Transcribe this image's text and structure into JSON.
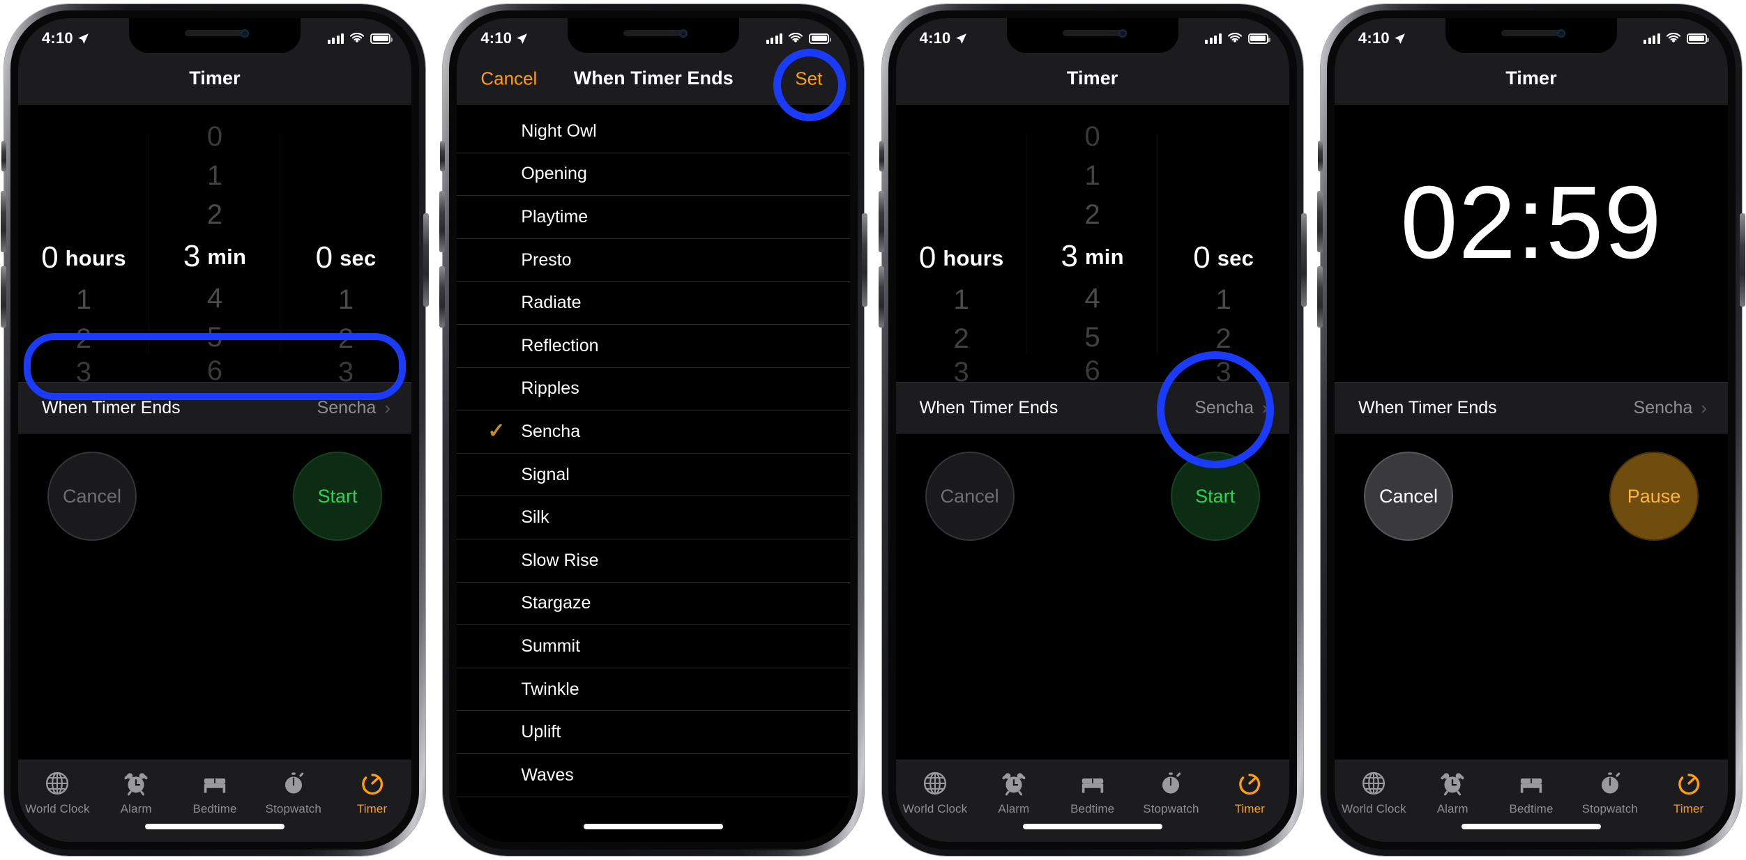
{
  "status_bar": {
    "time": "4:10",
    "location_icon": "location-arrow-icon",
    "cellular_icon": "cellular-bars-icon",
    "wifi_icon": "wifi-icon",
    "battery_icon": "battery-icon"
  },
  "tab_bar": {
    "items": [
      {
        "label": "World Clock",
        "icon": "globe-icon",
        "active": false
      },
      {
        "label": "Alarm",
        "icon": "alarm-clock-icon",
        "active": false
      },
      {
        "label": "Bedtime",
        "icon": "bed-icon",
        "active": false
      },
      {
        "label": "Stopwatch",
        "icon": "stopwatch-icon",
        "active": false
      },
      {
        "label": "Timer",
        "icon": "timer-icon",
        "active": true
      }
    ]
  },
  "colors": {
    "accent_orange": "#ff9f0a",
    "highlight_blue": "#1a3cfa",
    "start_green": "#30d158",
    "pause_orange": "#ffb340",
    "checkmark_gold": "#c78c2b"
  },
  "panel1": {
    "nav_title": "Timer",
    "picker": {
      "hours": {
        "above": [],
        "selected_value": "0",
        "selected_unit": "hours",
        "below": [
          "1",
          "2",
          "3"
        ]
      },
      "minutes": {
        "above": [
          "0",
          "1",
          "2"
        ],
        "selected_value": "3",
        "selected_unit": "min",
        "below": [
          "4",
          "5",
          "6"
        ]
      },
      "seconds": {
        "above": [],
        "selected_value": "0",
        "selected_unit": "sec",
        "below": [
          "1",
          "2",
          "3"
        ]
      }
    },
    "when_timer_ends": {
      "label": "When Timer Ends",
      "value": "Sencha",
      "chevron": "chevron-right-icon",
      "highlighted": true
    },
    "buttons": {
      "cancel": "Cancel",
      "start": "Start"
    }
  },
  "panel2": {
    "nav_left": "Cancel",
    "nav_title": "When Timer Ends",
    "nav_right": "Set",
    "nav_right_highlighted": true,
    "sounds": [
      {
        "name": "Night Owl",
        "selected": false
      },
      {
        "name": "Opening",
        "selected": false
      },
      {
        "name": "Playtime",
        "selected": false
      },
      {
        "name": "Presto",
        "selected": false
      },
      {
        "name": "Radiate",
        "selected": false
      },
      {
        "name": "Reflection",
        "selected": false
      },
      {
        "name": "Ripples",
        "selected": false
      },
      {
        "name": "Sencha",
        "selected": true
      },
      {
        "name": "Signal",
        "selected": false
      },
      {
        "name": "Silk",
        "selected": false
      },
      {
        "name": "Slow Rise",
        "selected": false
      },
      {
        "name": "Stargaze",
        "selected": false
      },
      {
        "name": "Summit",
        "selected": false
      },
      {
        "name": "Twinkle",
        "selected": false
      },
      {
        "name": "Uplift",
        "selected": false
      },
      {
        "name": "Waves",
        "selected": false
      }
    ],
    "checkmark_glyph": "✓"
  },
  "panel3": {
    "nav_title": "Timer",
    "picker": {
      "hours": {
        "above": [],
        "selected_value": "0",
        "selected_unit": "hours",
        "below": [
          "1",
          "2",
          "3"
        ]
      },
      "minutes": {
        "above": [
          "0",
          "1",
          "2"
        ],
        "selected_value": "3",
        "selected_unit": "min",
        "below": [
          "4",
          "5",
          "6"
        ]
      },
      "seconds": {
        "above": [],
        "selected_value": "0",
        "selected_unit": "sec",
        "below": [
          "1",
          "2",
          "3"
        ]
      }
    },
    "when_timer_ends": {
      "label": "When Timer Ends",
      "value": "Sencha",
      "chevron": "chevron-right-icon",
      "highlighted": false
    },
    "buttons": {
      "cancel": "Cancel",
      "start": "Start",
      "start_highlighted": true
    }
  },
  "panel4": {
    "nav_title": "Timer",
    "countdown": "02:59",
    "when_timer_ends": {
      "label": "When Timer Ends",
      "value": "Sencha",
      "chevron": "chevron-right-icon",
      "highlighted": false
    },
    "buttons": {
      "cancel": "Cancel",
      "pause": "Pause"
    }
  }
}
